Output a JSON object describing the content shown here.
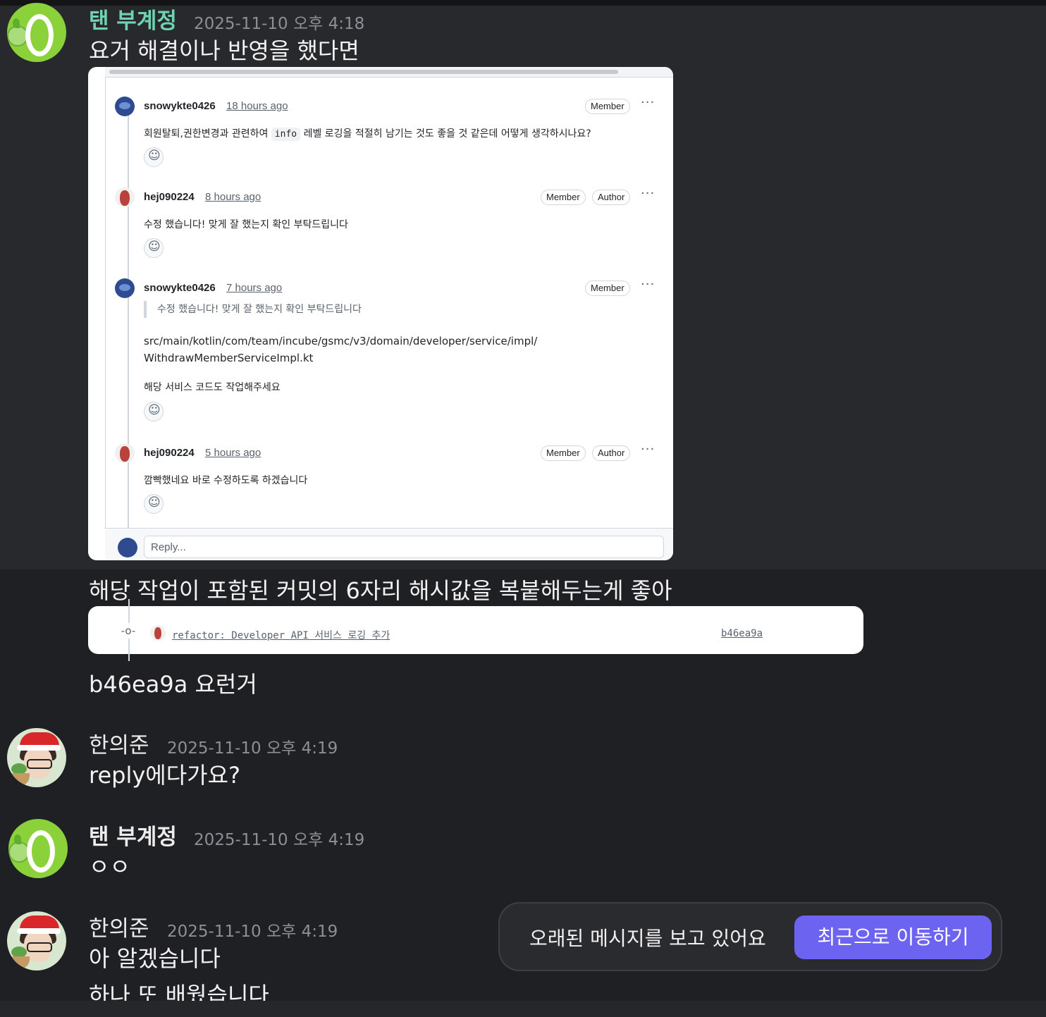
{
  "messages": [
    {
      "author": "탠 부계정",
      "time": "2025-11-10 오후 4:18",
      "lines": [
        "요거 해결이나 반영을 했다면",
        "해당 작업이 포함된 커밋의 6자리 해시값을 복붙해두는게 좋아",
        "b46ea9a 요런거"
      ]
    },
    {
      "author": "한의준",
      "time": "2025-11-10 오후 4:19",
      "lines": [
        "reply에다가요?"
      ]
    },
    {
      "author": "탠 부계정",
      "time": "2025-11-10 오후 4:19",
      "lines": [
        "ㅇㅇ"
      ]
    },
    {
      "author": "한의준",
      "time": "2025-11-10 오후 4:19",
      "lines": [
        "아 알겠습니다",
        "하나 또 배웠습니다"
      ]
    }
  ],
  "github_thread": {
    "comments": [
      {
        "user": "snowykte0426",
        "ago": "18 hours ago",
        "badges": [
          "Member"
        ],
        "text_before": "회원탈퇴,권한변경과 관련하여",
        "code": "info",
        "text_after": "레벨 로깅을 적절히 남기는 것도 좋을 것 같은데 어떻게 생각하시나요?"
      },
      {
        "user": "hej090224",
        "ago": "8 hours ago",
        "badges": [
          "Member",
          "Author"
        ],
        "text": "수정 했습니다! 맞게 잘 했는지 확인 부탁드립니다"
      },
      {
        "user": "snowykte0426",
        "ago": "7 hours ago",
        "badges": [
          "Member"
        ],
        "quote": "수정 했습니다! 맞게 잘 했는지 확인 부탁드립니다",
        "path_line1": "src/main/kotlin/com/team/incube/gsmc/v3/domain/developer/service/impl/",
        "path_line2": "WithdrawMemberServiceImpl.kt",
        "text": "해당 서비스 코드도 작업해주세요"
      },
      {
        "user": "hej090224",
        "ago": "5 hours ago",
        "badges": [
          "Member",
          "Author"
        ],
        "text": "깜빡했네요 바로 수정하도록 하겠습니다"
      }
    ],
    "more_label": "···",
    "reply_placeholder": "Reply..."
  },
  "commit": {
    "message": "refactor: Developer API 서비스 로깅 추가",
    "hash": "b46ea9a",
    "node_glyph": "-o-"
  },
  "toast": {
    "message": "오래된 메시지를 보고 있어요",
    "button": "최근으로 이동하기"
  },
  "colors": {
    "background": "#1f2023",
    "highlight": "#28292c",
    "author_accent": "#6fd3b1",
    "button": "#6c63f0"
  }
}
